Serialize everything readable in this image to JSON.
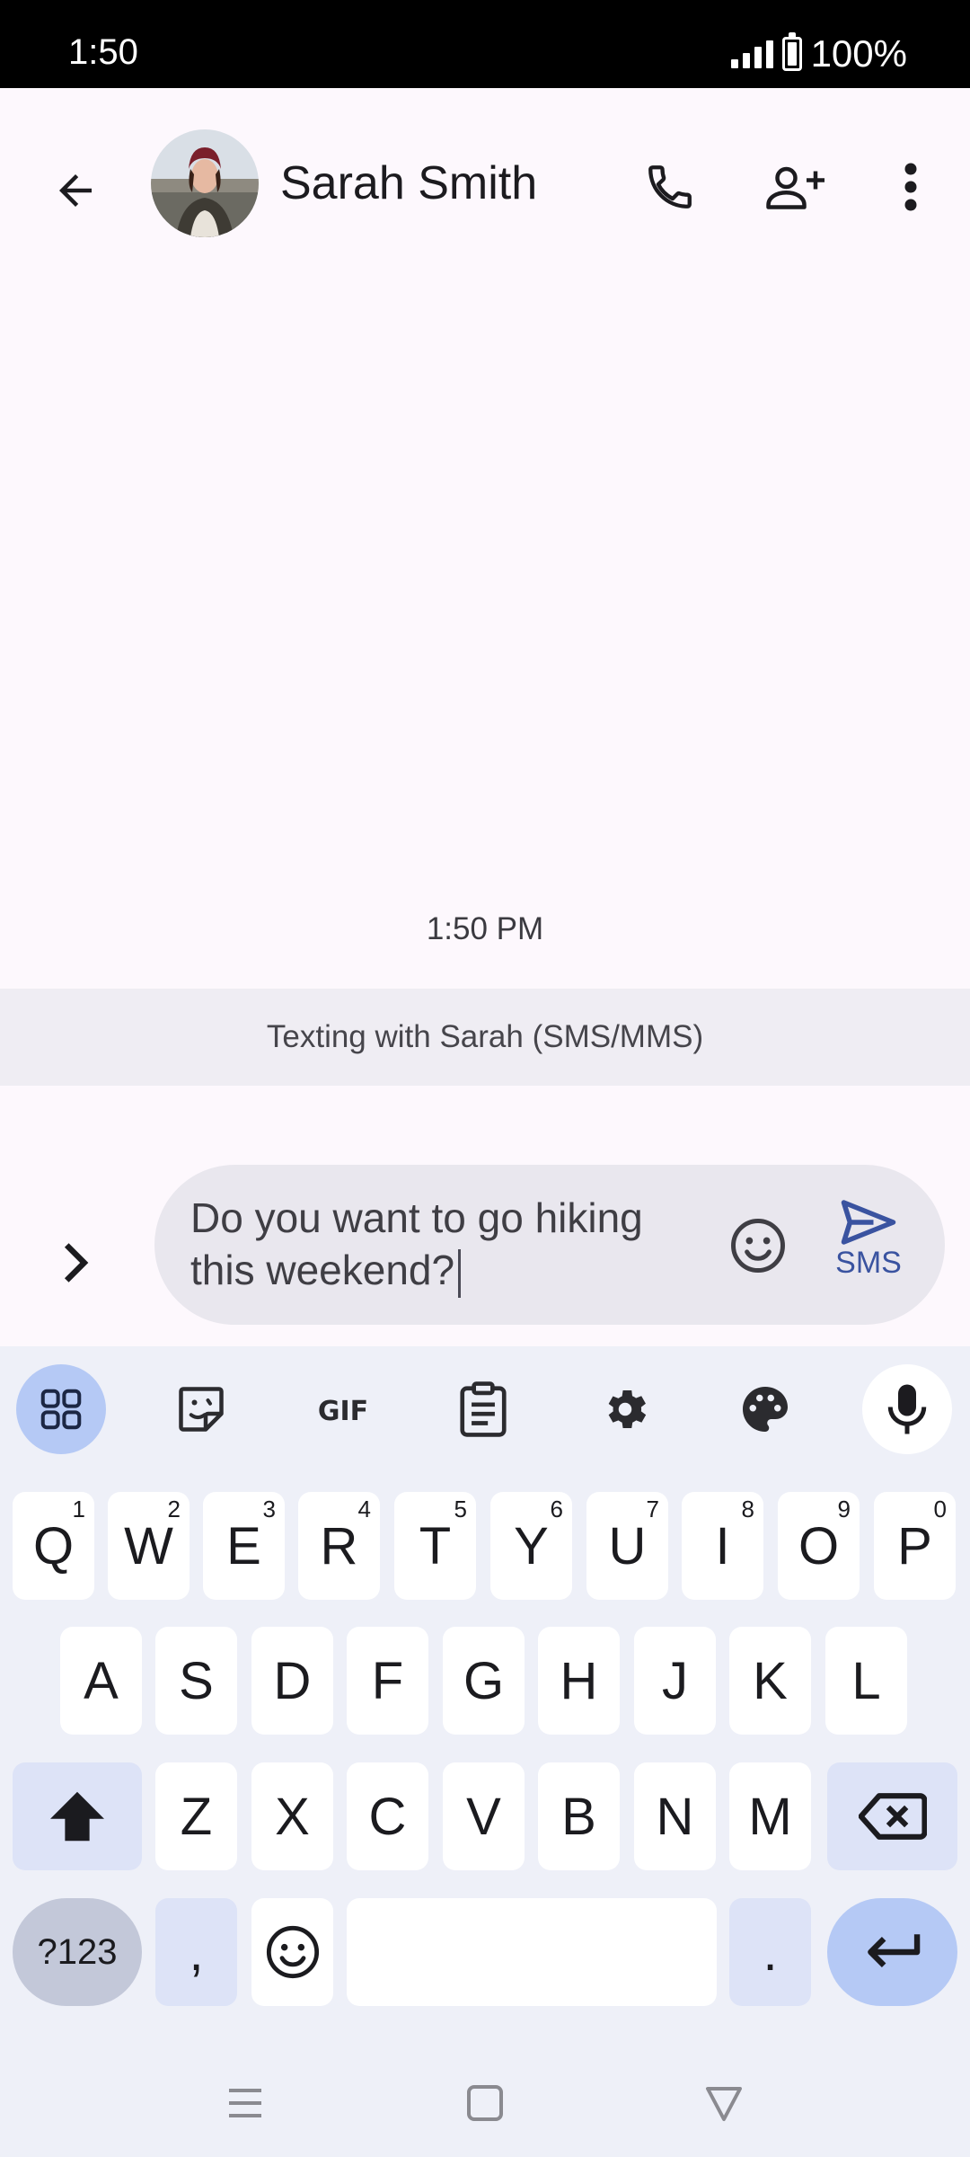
{
  "status_bar": {
    "time": "1:50",
    "battery": "100%"
  },
  "header": {
    "contact_name": "Sarah Smith"
  },
  "conversation": {
    "timestamp": "1:50 PM",
    "banner": "Texting with Sarah (SMS/MMS)"
  },
  "compose": {
    "text": "Do you want to go hiking\nthis weekend?",
    "send_label": "SMS"
  },
  "keyboard": {
    "row1": [
      {
        "key": "Q",
        "sup": "1"
      },
      {
        "key": "W",
        "sup": "2"
      },
      {
        "key": "E",
        "sup": "3"
      },
      {
        "key": "R",
        "sup": "4"
      },
      {
        "key": "T",
        "sup": "5"
      },
      {
        "key": "Y",
        "sup": "6"
      },
      {
        "key": "U",
        "sup": "7"
      },
      {
        "key": "I",
        "sup": "8"
      },
      {
        "key": "O",
        "sup": "9"
      },
      {
        "key": "P",
        "sup": "0"
      }
    ],
    "row2": [
      "A",
      "S",
      "D",
      "F",
      "G",
      "H",
      "J",
      "K",
      "L"
    ],
    "row3": [
      "Z",
      "X",
      "C",
      "V",
      "B",
      "N",
      "M"
    ],
    "symbols_label": "?123",
    "comma_label": ",",
    "period_label": "."
  },
  "colors": {
    "accent": "#b5c9f5",
    "send_icon": "#3a53a0",
    "keyboard_bg": "#eef0f8",
    "compose_bg": "#e9e7ee"
  }
}
